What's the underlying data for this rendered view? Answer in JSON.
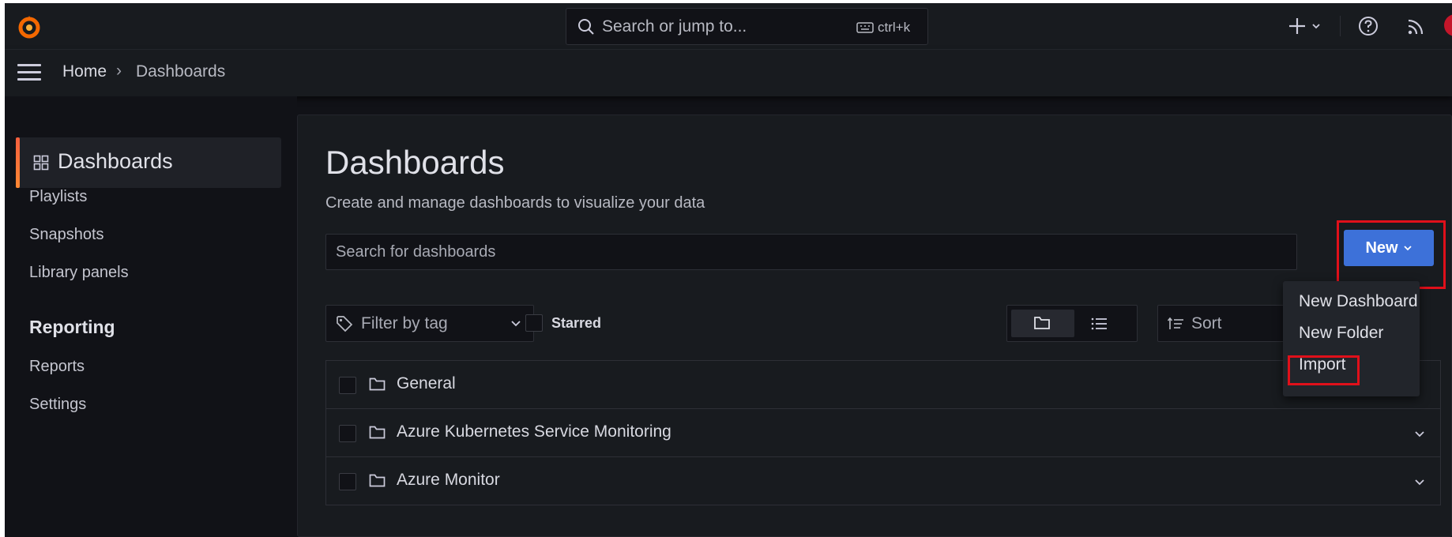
{
  "topbar": {
    "search_placeholder": "Search or jump to...",
    "shortcut": "ctrl+k",
    "icons": [
      "grafana-logo-icon",
      "search-icon",
      "keyboard-icon",
      "plus-icon",
      "chevron-down-icon",
      "help-icon",
      "rss-icon"
    ]
  },
  "breadcrumb": {
    "home": "Home",
    "separator": "›",
    "current": "Dashboards"
  },
  "sidebar": {
    "active": "Dashboards",
    "items": [
      "Playlists",
      "Snapshots",
      "Library panels"
    ],
    "section": "Reporting",
    "section_items": [
      "Reports",
      "Settings"
    ]
  },
  "main": {
    "title": "Dashboards",
    "subtitle": "Create and manage dashboards to visualize your data",
    "search_placeholder": "Search for dashboards",
    "new_button": "New",
    "filter_placeholder": "Filter by tag",
    "starred_label": "Starred",
    "sort_placeholder": "Sort",
    "folders": [
      {
        "name": "General"
      },
      {
        "name": "Azure Kubernetes Service Monitoring"
      },
      {
        "name": "Azure Monitor"
      }
    ]
  },
  "new_menu": {
    "items": [
      "New Dashboard",
      "New Folder",
      "Import"
    ]
  },
  "colors": {
    "background": "#111217",
    "panel": "#181b1f",
    "primary_button": "#3d71d9",
    "accent": "#ff8833",
    "highlight_box": "#e0101a"
  }
}
